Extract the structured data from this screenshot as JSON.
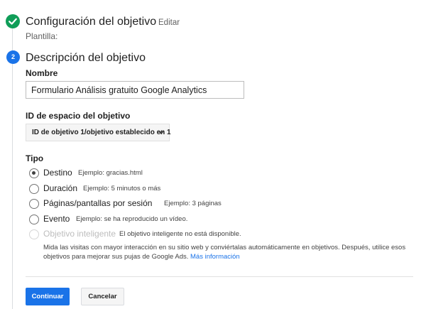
{
  "step1": {
    "title": "Configuración del objetivo",
    "edit_label": "Editar",
    "template_label": "Plantilla:",
    "icon": "check-icon",
    "status_color": "#0f9d58"
  },
  "step2": {
    "number": "2",
    "title": "Descripción del objetivo",
    "accent_color": "#1a73e8"
  },
  "name_field": {
    "label": "Nombre",
    "value": "Formulario Análisis gratuito Google Analytics"
  },
  "goal_slot": {
    "label": "ID de espacio del objetivo",
    "selected": "ID de objetivo 1/objetivo establecido en 1"
  },
  "type": {
    "label": "Tipo",
    "options": [
      {
        "label": "Destino",
        "example": "Ejemplo: gracias.html",
        "checked": true,
        "disabled": false
      },
      {
        "label": "Duración",
        "example": "Ejemplo: 5 minutos o más",
        "checked": false,
        "disabled": false
      },
      {
        "label": "Páginas/pantallas por sesión",
        "example": "Ejemplo: 3 páginas",
        "checked": false,
        "disabled": false
      },
      {
        "label": "Evento",
        "example": "Ejemplo: se ha reproducido un vídeo.",
        "checked": false,
        "disabled": false
      },
      {
        "label": "Objetivo inteligente",
        "example": "El objetivo inteligente no está disponible.",
        "checked": false,
        "disabled": true
      }
    ],
    "smart_description": "Mida las visitas con mayor interacción en su sitio web y conviértalas automáticamente en objetivos. Después, utilice esos objetivos para mejorar sus pujas de Google Ads.",
    "more_info_link": "Más información"
  },
  "buttons": {
    "continue": "Continuar",
    "cancel": "Cancelar"
  }
}
